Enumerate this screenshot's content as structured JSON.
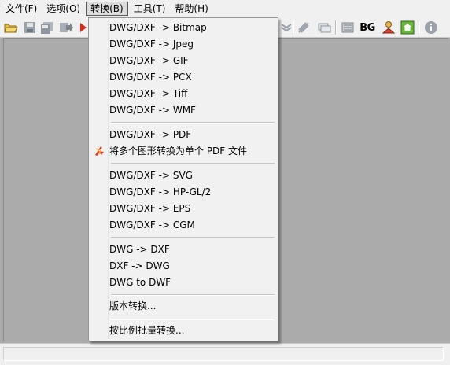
{
  "menubar": {
    "items": [
      {
        "label": "文件(F)"
      },
      {
        "label": "选项(O)"
      },
      {
        "label": "转换(B)"
      },
      {
        "label": "工具(T)"
      },
      {
        "label": "帮助(H)"
      }
    ]
  },
  "toolbar": {
    "bg_label": "BG"
  },
  "dropdown": {
    "items": [
      {
        "label": "DWG/DXF -> Bitmap"
      },
      {
        "label": "DWG/DXF -> Jpeg"
      },
      {
        "label": "DWG/DXF -> GIF"
      },
      {
        "label": "DWG/DXF -> PCX"
      },
      {
        "label": "DWG/DXF -> Tiff"
      },
      {
        "label": "DWG/DXF -> WMF"
      },
      {
        "label": "DWG/DXF -> PDF"
      },
      {
        "label": "将多个图形转换为单个 PDF 文件"
      },
      {
        "label": "DWG/DXF -> SVG"
      },
      {
        "label": "DWG/DXF -> HP-GL/2"
      },
      {
        "label": "DWG/DXF -> EPS"
      },
      {
        "label": "DWG/DXF -> CGM"
      },
      {
        "label": "DWG -> DXF"
      },
      {
        "label": "DXF -> DWG"
      },
      {
        "label": "DWG to DWF"
      },
      {
        "label": "版本转换..."
      },
      {
        "label": "按比例批量转换..."
      }
    ]
  },
  "colors": {
    "chrome": "#f0f0f0",
    "workspace": "#ababab",
    "menu_bg": "#f1f1f1"
  }
}
